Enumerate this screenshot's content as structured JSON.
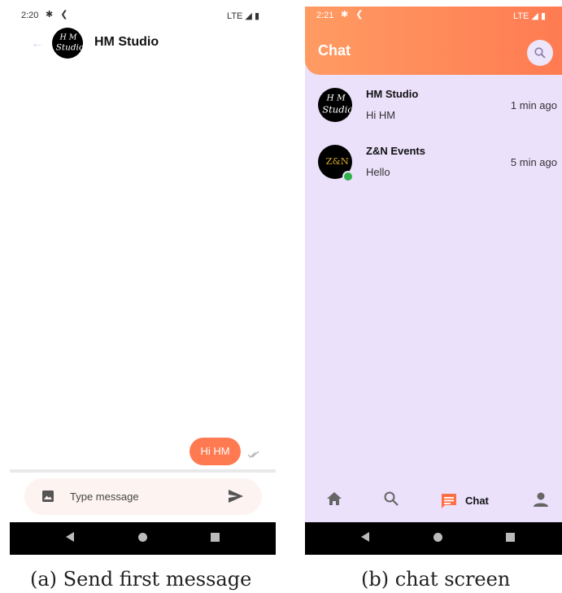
{
  "screen_a": {
    "status": {
      "time": "2:20",
      "network": "LTE ◢ ▮"
    },
    "header": {
      "title": "HM Studio",
      "avatar_text": "HM Studio"
    },
    "message": {
      "text": "Hi HM",
      "status_icon": "double-check-icon"
    },
    "input": {
      "placeholder": "Type message"
    },
    "caption": "(a) Send first message"
  },
  "screen_b": {
    "status": {
      "time": "2:21",
      "network": "LTE ◢ ▮"
    },
    "header": {
      "title": "Chat"
    },
    "chats": [
      {
        "name": "HM Studio",
        "last_message": "Hi HM",
        "time": "1 min ago",
        "avatar_text": "HM Studio",
        "online": false
      },
      {
        "name": "Z&N Events",
        "last_message": "Hello",
        "time": "5 min ago",
        "avatar_text": "Z&N",
        "online": true
      }
    ],
    "bottom_nav": {
      "active_label": "Chat"
    },
    "caption": "(b) chat screen"
  },
  "colors": {
    "accent": "#ff7a51",
    "lavender_bg": "#ebe1fb",
    "online": "#2fb24a"
  }
}
